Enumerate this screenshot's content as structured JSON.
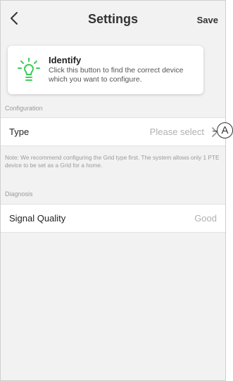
{
  "header": {
    "title": "Settings",
    "save_label": "Save"
  },
  "identify": {
    "title": "Identify",
    "description": "Click this button to find the correct device which you want to configure."
  },
  "configuration": {
    "section_label": "Configuration",
    "type_label": "Type",
    "type_value": "Please select",
    "note": "Note: We recommend configuring the Grid type first. The system allows only 1 PTE device to be set as a Grid for a home."
  },
  "diagnosis": {
    "section_label": "Diagnosis",
    "signal_label": "Signal Quality",
    "signal_value": "Good"
  },
  "callout": {
    "label": "A"
  },
  "colors": {
    "background": "#f2f2f2",
    "bulb_green": "#3dcd58",
    "text_dark": "#222222",
    "text_muted": "#9a9a9a"
  }
}
